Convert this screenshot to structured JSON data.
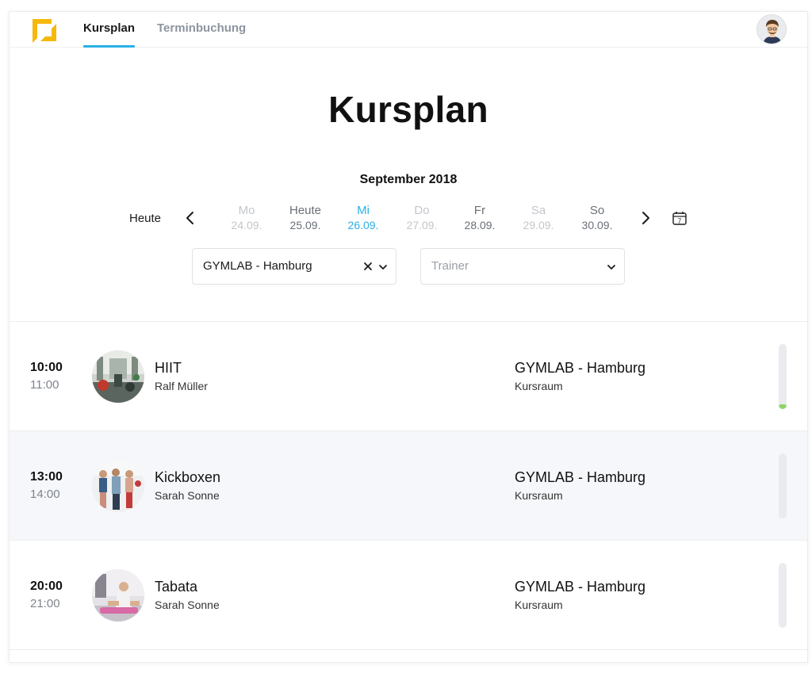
{
  "nav": {
    "tabs": [
      {
        "label": "Kursplan",
        "active": true
      },
      {
        "label": "Terminbuchung",
        "active": false
      }
    ],
    "accent_color": "#2bb0e6",
    "logo_color": "#f5b80b"
  },
  "page": {
    "title": "Kursplan",
    "month": "September 2018"
  },
  "date_strip": {
    "today_label": "Heute",
    "days": [
      {
        "name": "Mo",
        "date": "24.09.",
        "state": "muted"
      },
      {
        "name": "Heute",
        "date": "25.09.",
        "state": "normal"
      },
      {
        "name": "Mi",
        "date": "26.09.",
        "state": "selected"
      },
      {
        "name": "Do",
        "date": "27.09.",
        "state": "muted"
      },
      {
        "name": "Fr",
        "date": "28.09.",
        "state": "normal"
      },
      {
        "name": "Sa",
        "date": "29.09.",
        "state": "muted"
      },
      {
        "name": "So",
        "date": "30.09.",
        "state": "normal"
      }
    ],
    "calendar_icon_number": "7"
  },
  "filters": {
    "location_value": "GYMLAB - Hamburg",
    "trainer_placeholder": "Trainer"
  },
  "courses": [
    {
      "start": "10:00",
      "end": "11:00",
      "name": "HIIT",
      "trainer": "Ralf Müller",
      "location": "GYMLAB - Hamburg",
      "room": "Kursraum",
      "capacity_fill": 0.05
    },
    {
      "start": "13:00",
      "end": "14:00",
      "name": "Kickboxen",
      "trainer": "Sarah Sonne",
      "location": "GYMLAB - Hamburg",
      "room": "Kursraum",
      "capacity_fill": 0
    },
    {
      "start": "20:00",
      "end": "21:00",
      "name": "Tabata",
      "trainer": "Sarah Sonne",
      "location": "GYMLAB - Hamburg",
      "room": "Kursraum",
      "capacity_fill": 0
    }
  ]
}
